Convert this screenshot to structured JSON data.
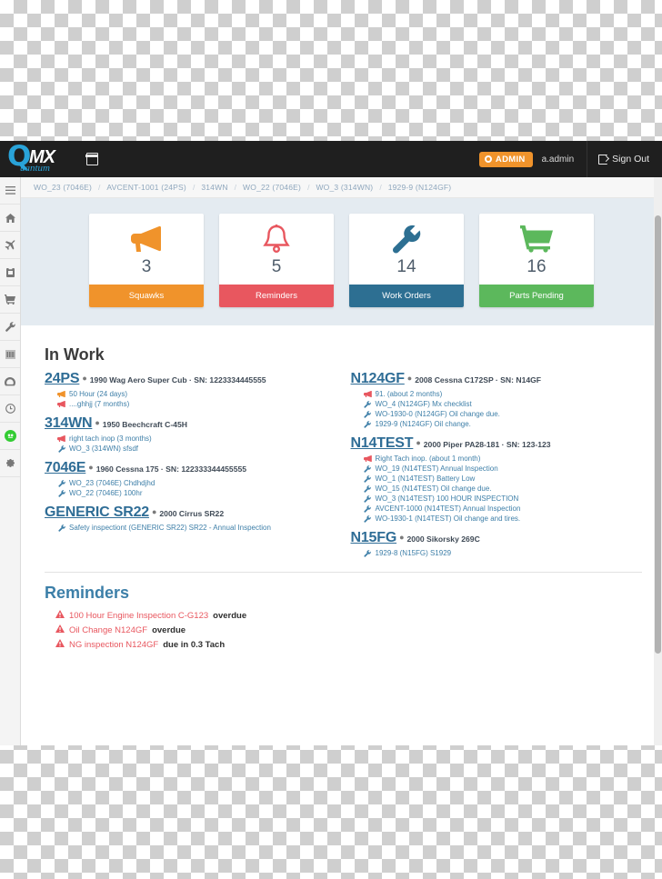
{
  "header": {
    "logo_q": "Q",
    "logo_mx": "MX",
    "logo_quantum": "uantum",
    "calendar_icon": "calendar-icon",
    "admin_label": "ADMIN",
    "username": "a.admin",
    "signout_label": "Sign Out"
  },
  "sidebar": {
    "items": [
      {
        "name": "menu-toggle",
        "icon": "hamburger-icon"
      },
      {
        "name": "home",
        "icon": "home-icon"
      },
      {
        "name": "aircraft",
        "icon": "plane-icon"
      },
      {
        "name": "logbook",
        "icon": "clipboard-icon"
      },
      {
        "name": "parts",
        "icon": "cart-icon"
      },
      {
        "name": "maintenance",
        "icon": "wrench-icon"
      },
      {
        "name": "reports",
        "icon": "bars-icon"
      },
      {
        "name": "dashboard",
        "icon": "gauge-icon"
      },
      {
        "name": "reminders",
        "icon": "clock-icon"
      },
      {
        "name": "status",
        "icon": "green-badge-icon"
      },
      {
        "name": "settings",
        "icon": "gear-icon"
      }
    ]
  },
  "breadcrumbs": [
    "WO_23 (7046E)",
    "AVCENT-1001 (24PS)",
    "314WN",
    "WO_22 (7046E)",
    "WO_3 (314WN)",
    "1929-9 (N124GF)"
  ],
  "breadcrumb_separator": "/",
  "stats": [
    {
      "count": "3",
      "label": "Squawks",
      "icon": "megaphone-icon",
      "color": "#f0932b"
    },
    {
      "count": "5",
      "label": "Reminders",
      "icon": "bell-icon",
      "color": "#e8575f"
    },
    {
      "count": "14",
      "label": "Work Orders",
      "icon": "wrench-icon",
      "color": "#2d6f92"
    },
    {
      "count": "16",
      "label": "Parts Pending",
      "icon": "cart-icon",
      "color": "#5cb85c"
    }
  ],
  "in_work": {
    "title": "In Work",
    "left": [
      {
        "tail": "24PS",
        "desc": "1990 Wag Aero Super Cub · SN: 1223334445555",
        "items": [
          {
            "type": "squawk",
            "color": "#f0932b",
            "text": "50 Hour (24 days)"
          },
          {
            "type": "squawk",
            "color": "#e8575f",
            "text": "....ghhjj (7 months)"
          }
        ]
      },
      {
        "tail": "314WN",
        "desc": "1950 Beechcraft C-45H",
        "items": [
          {
            "type": "squawk",
            "color": "#e8575f",
            "text": "right tach inop (3 months)"
          },
          {
            "type": "wo",
            "color": "#3e7fa8",
            "text": "WO_3 (314WN) sfsdf"
          }
        ]
      },
      {
        "tail": "7046E",
        "desc": "1960 Cessna 175 · SN: 122333344455555",
        "items": [
          {
            "type": "wo",
            "color": "#3e7fa8",
            "text": "WO_23 (7046E) Chdhdjhd"
          },
          {
            "type": "wo",
            "color": "#3e7fa8",
            "text": "WO_22 (7046E) 100hr"
          }
        ]
      },
      {
        "tail": "GENERIC SR22",
        "desc": "2000 Cirrus SR22",
        "items": [
          {
            "type": "wo",
            "color": "#3e7fa8",
            "text": "Safety inspectiont (GENERIC SR22) SR22 - Annual Inspection"
          }
        ]
      }
    ],
    "right": [
      {
        "tail": "N124GF",
        "desc": "2008 Cessna C172SP · SN: N14GF",
        "items": [
          {
            "type": "squawk",
            "color": "#e8575f",
            "text": "91. (about 2 months)"
          },
          {
            "type": "wo",
            "color": "#3e7fa8",
            "text": "WO_4 (N124GF) Mx checklist"
          },
          {
            "type": "wo",
            "color": "#3e7fa8",
            "text": "WO-1930-0 (N124GF) Oil change due."
          },
          {
            "type": "wo",
            "color": "#3e7fa8",
            "text": "1929-9 (N124GF) Oil change."
          }
        ]
      },
      {
        "tail": "N14TEST",
        "desc": "2000 Piper PA28-181 · SN: 123-123",
        "items": [
          {
            "type": "squawk",
            "color": "#e8575f",
            "text": "Right Tach inop. (about 1 month)"
          },
          {
            "type": "wo",
            "color": "#3e7fa8",
            "text": "WO_19 (N14TEST) Annual Inspection"
          },
          {
            "type": "wo",
            "color": "#3e7fa8",
            "text": "WO_1 (N14TEST) Battery Low"
          },
          {
            "type": "wo",
            "color": "#3e7fa8",
            "text": "WO_15 (N14TEST) Oil change due."
          },
          {
            "type": "wo",
            "color": "#3e7fa8",
            "text": "WO_3 (N14TEST) 100 HOUR INSPECTION"
          },
          {
            "type": "wo",
            "color": "#3e7fa8",
            "text": "AVCENT-1000 (N14TEST) Annual Inspection"
          },
          {
            "type": "wo",
            "color": "#3e7fa8",
            "text": "WO-1930-1 (N14TEST) Oil change and tires."
          }
        ]
      },
      {
        "tail": "N15FG",
        "desc": "2000 Sikorsky 269C",
        "items": [
          {
            "type": "wo",
            "color": "#3e7fa8",
            "text": "1929-8 (N15FG) S1929"
          }
        ]
      }
    ]
  },
  "reminders": {
    "title": "Reminders",
    "items": [
      {
        "link": "100 Hour Engine Inspection C-G123",
        "tail": "overdue"
      },
      {
        "link": "Oil Change N124GF",
        "tail": "overdue"
      },
      {
        "link": "NG inspection N124GF",
        "tail": "due in 0.3 Tach"
      }
    ]
  },
  "colors": {
    "orange": "#f0932b",
    "red": "#e8575f",
    "blue": "#2d6f92",
    "green": "#5cb85c",
    "link": "#3e7fa8",
    "panel_bg": "#e4ebf1",
    "topbar": "#1f1f1f"
  }
}
